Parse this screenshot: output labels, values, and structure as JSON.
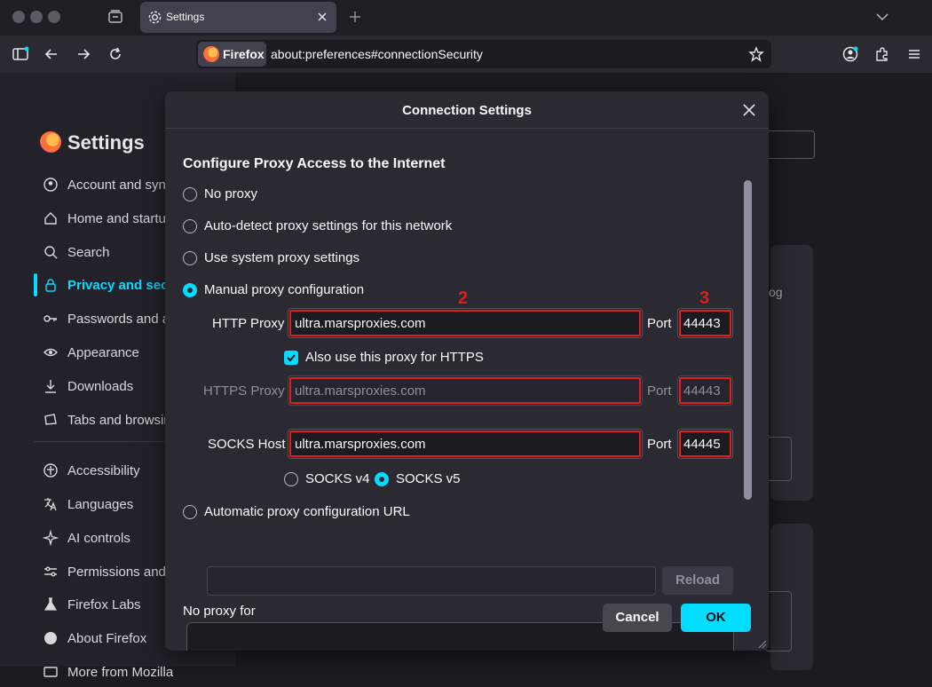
{
  "browser": {
    "tab_title": "Settings",
    "identity_label": "Firefox",
    "url": "about:preferences#connectionSecurity"
  },
  "settings_page": {
    "title": "Settings",
    "nav": [
      {
        "label": "Account and sync",
        "icon": "account-icon"
      },
      {
        "label": "Home and startup",
        "icon": "home-icon"
      },
      {
        "label": "Search",
        "icon": "search-icon"
      },
      {
        "label": "Privacy and security",
        "icon": "lock-icon",
        "active": true
      },
      {
        "label": "Passwords and autofill",
        "icon": "key-icon"
      },
      {
        "label": "Appearance",
        "icon": "eye-icon"
      },
      {
        "label": "Downloads",
        "icon": "download-icon"
      },
      {
        "label": "Tabs and browsing",
        "icon": "tabs-icon"
      },
      {
        "label": "Accessibility",
        "icon": "accessibility-icon"
      },
      {
        "label": "Languages",
        "icon": "language-icon"
      },
      {
        "label": "AI controls",
        "icon": "sparkle-icon"
      },
      {
        "label": "Permissions and",
        "icon": "sliders-icon"
      },
      {
        "label": "Firefox Labs",
        "icon": "flask-icon"
      },
      {
        "label": "About Firefox",
        "icon": "firefox-icon"
      },
      {
        "label": "More from Mozilla",
        "icon": "mozilla-icon"
      }
    ],
    "bg_fragment": "og"
  },
  "dialog": {
    "title": "Connection Settings",
    "section_title": "Configure Proxy Access to the Internet",
    "options": {
      "no_proxy": "No proxy",
      "auto_detect": "Auto-detect proxy settings for this network",
      "system": "Use system proxy settings",
      "manual": "Manual proxy configuration",
      "auto_url": "Automatic proxy configuration URL"
    },
    "selected_option": "manual",
    "http_proxy": {
      "label": "HTTP Proxy",
      "value": "ultra.marsproxies.com",
      "port_label": "Port",
      "port": "44443"
    },
    "also_https": {
      "label": "Also use this proxy for HTTPS",
      "checked": true
    },
    "https_proxy": {
      "label": "HTTPS Proxy",
      "value": "ultra.marsproxies.com",
      "port_label": "Port",
      "port": "44443"
    },
    "socks_host": {
      "label": "SOCKS Host",
      "value": "ultra.marsproxies.com",
      "port_label": "Port",
      "port": "44445"
    },
    "socks_v4": "SOCKS v4",
    "socks_v5": "SOCKS v5",
    "socks_selected": "v5",
    "auto_url_value": "",
    "reload_label": "Reload",
    "no_proxy_for_label": "No proxy for",
    "cancel_label": "Cancel",
    "ok_label": "OK",
    "annotations": [
      "2",
      "3"
    ],
    "highlight_color": "#e11d1d",
    "accent_color": "#00ddff"
  }
}
